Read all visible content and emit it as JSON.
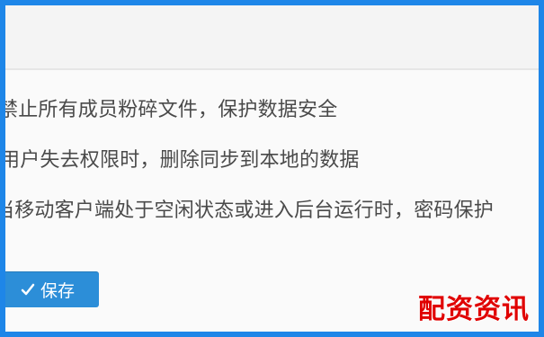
{
  "options": [
    "禁止所有成员粉碎文件，保护数据安全",
    "用户失去权限时，删除同步到本地的数据",
    "当移动客户端处于空闲状态或进入后台运行时，密码保护"
  ],
  "save_button_label": "保存",
  "icons": {
    "save_icon": "check-icon"
  },
  "colors": {
    "frame_border": "#1e86e8",
    "button_bg": "#2c8ed8",
    "watermark": "#e00000"
  },
  "watermark_text": "配资资讯"
}
